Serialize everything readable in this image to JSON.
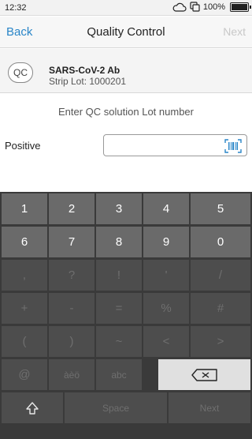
{
  "status_bar": {
    "time": "12:32",
    "battery": "100%"
  },
  "nav": {
    "back": "Back",
    "title": "Quality Control",
    "next": "Next"
  },
  "info": {
    "badge": "QC",
    "name": "SARS-CoV-2 Ab",
    "lot": "Strip Lot: 1000201"
  },
  "prompt": "Enter QC solution Lot number",
  "field": {
    "label": "Positive",
    "value": ""
  },
  "keyboard": {
    "row1": [
      "1",
      "2",
      "3",
      "4",
      "5"
    ],
    "row2": [
      "6",
      "7",
      "8",
      "9",
      "0"
    ],
    "row3": [
      ",",
      "?",
      "!",
      "'",
      "/"
    ],
    "row4": [
      "+",
      "-",
      "=",
      "%",
      "#"
    ],
    "row5": [
      "(",
      ")",
      "~",
      "<",
      ">"
    ],
    "row6": [
      "@",
      "àèö",
      "abc"
    ],
    "space": "Space",
    "next": "Next"
  },
  "icons": {
    "status": [
      "cloud-icon",
      "copy-icon",
      "battery-icon"
    ],
    "field": "barcode-icon",
    "keys": [
      "backspace-icon",
      "shift-icon"
    ]
  }
}
